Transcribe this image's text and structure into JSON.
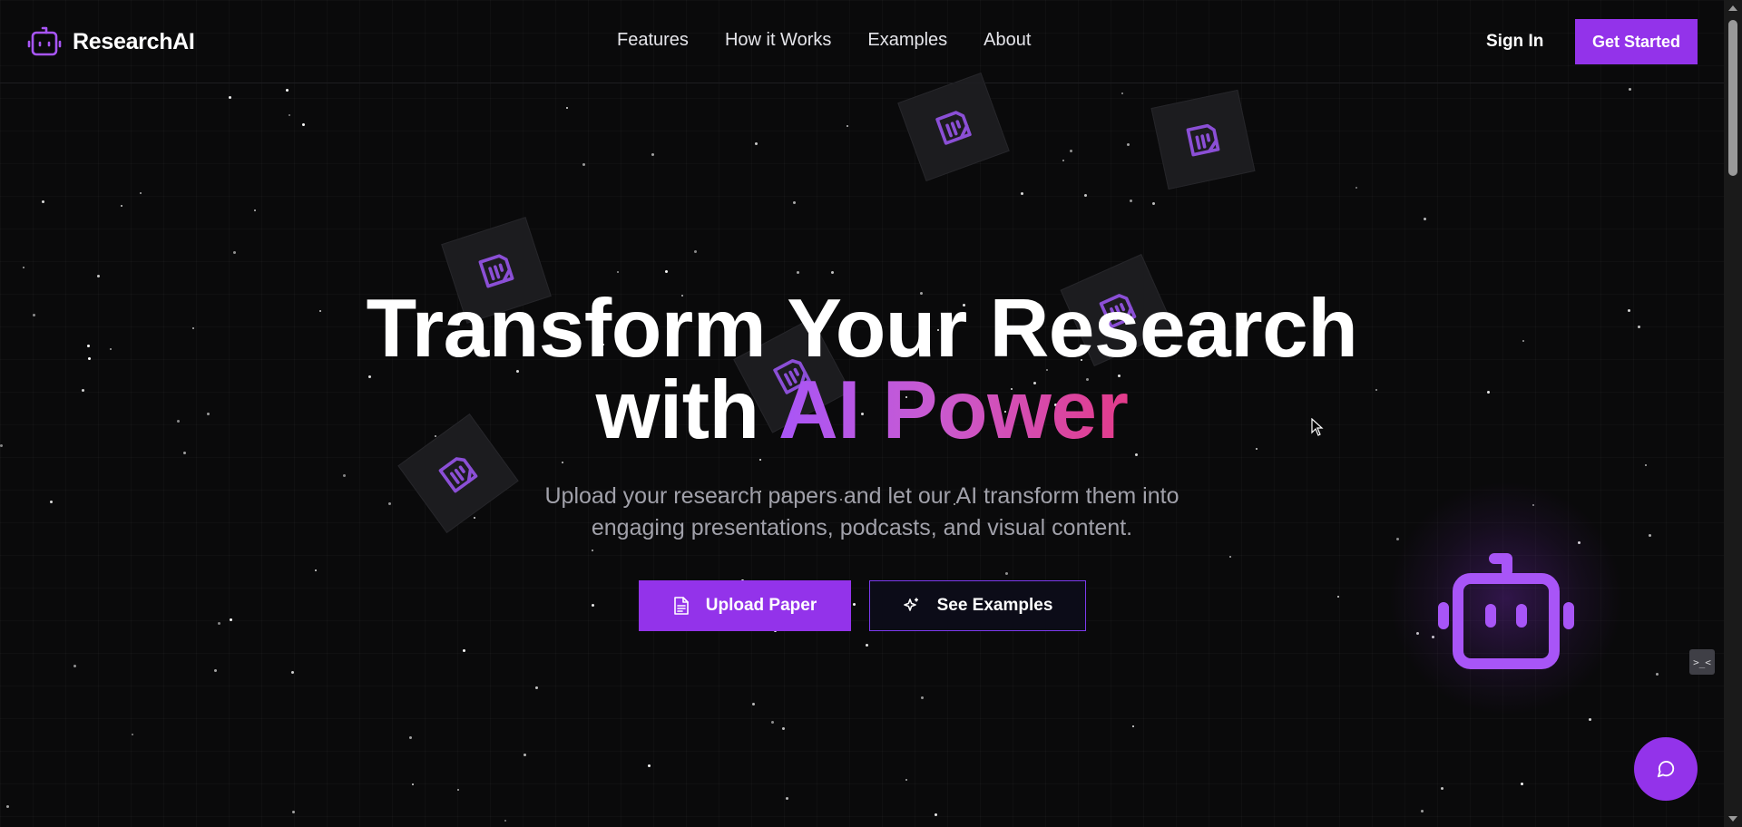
{
  "brand": {
    "name": "ResearchAI",
    "icon": "robot-icon",
    "accent": "#9333ea"
  },
  "nav": {
    "links": [
      "Features",
      "How it Works",
      "Examples",
      "About"
    ],
    "sign_in": "Sign In",
    "get_started": "Get Started"
  },
  "hero": {
    "title_line1": "Transform Your Research",
    "title_line2_plain": "with ",
    "title_line2_gradient": "AI Power",
    "subtitle_line1": "Upload your research papers and let our AI transform them into",
    "subtitle_line2": "engaging presentations, podcasts, and visual content.",
    "primary_button": {
      "label": "Upload Paper",
      "icon": "file-icon"
    },
    "secondary_button": {
      "label": "See Examples",
      "icon": "sparkles-icon"
    }
  },
  "floating_cards_icon": "document-icon",
  "widgets": {
    "side_widget": ">_<",
    "chat_icon": "message-circle-icon"
  },
  "colors": {
    "background": "#0a0a0b",
    "gradient_start": "#a855f7",
    "gradient_end": "#e33b8a",
    "muted_text": "#a1a1aa"
  }
}
